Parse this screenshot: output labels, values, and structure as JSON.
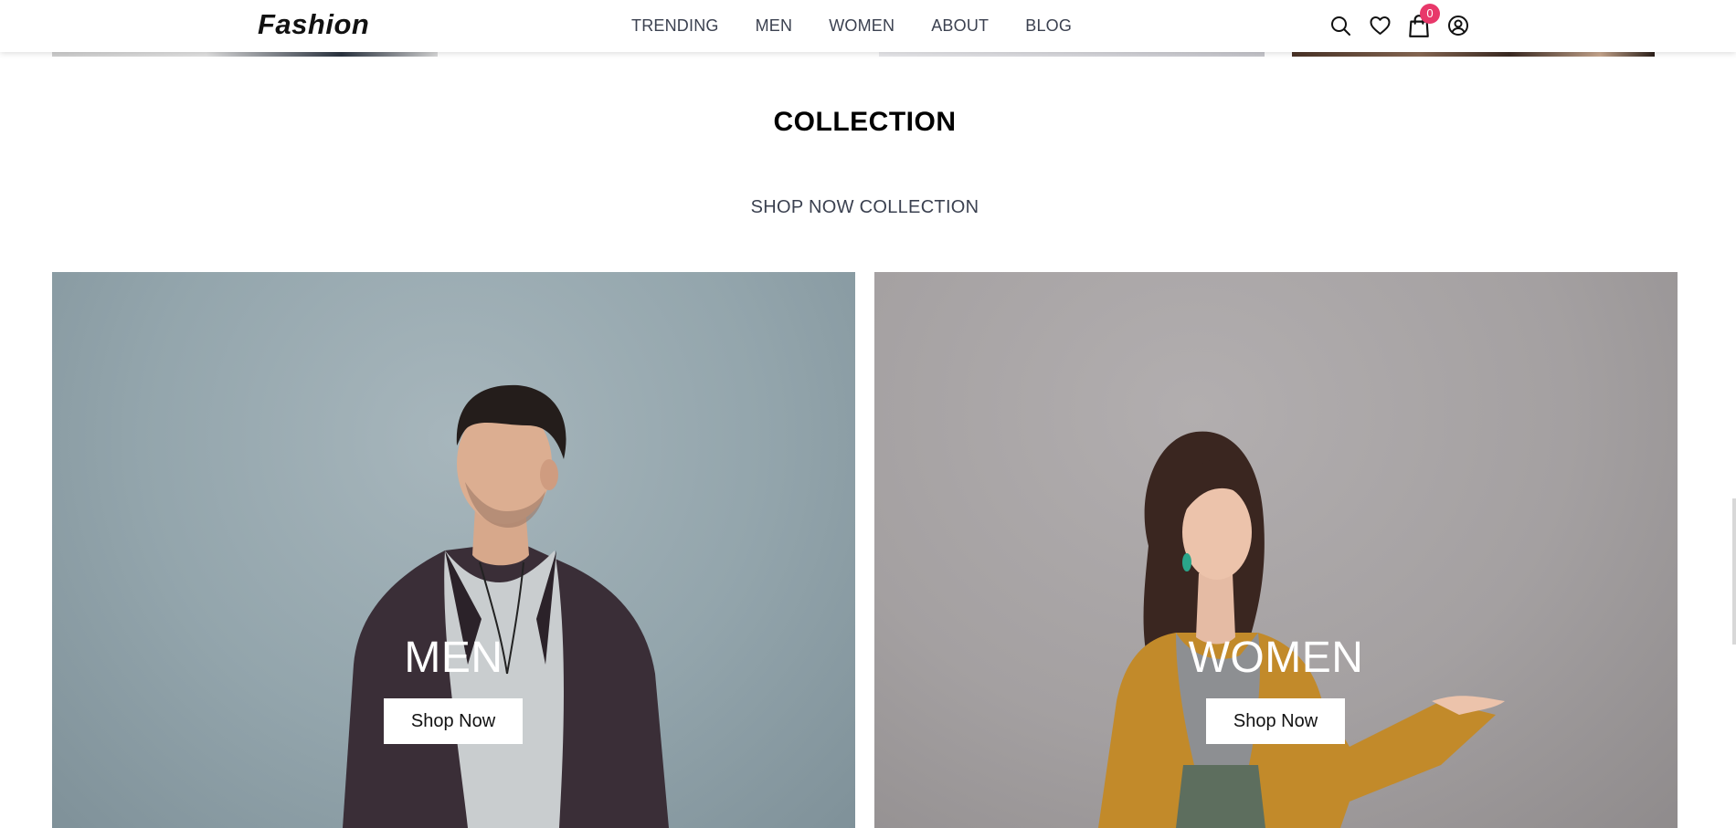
{
  "header": {
    "logo": "Fashion",
    "nav": [
      "TRENDING",
      "MEN",
      "WOMEN",
      "ABOUT",
      "BLOG"
    ],
    "cart_count": "0",
    "icons": [
      "search-icon",
      "heart-icon",
      "cart-icon",
      "user-icon"
    ]
  },
  "collection": {
    "title": "COLLECTION",
    "subtitle": "SHOP NOW COLLECTION",
    "cards": [
      {
        "label": "MEN",
        "button": "Shop Now"
      },
      {
        "label": "WOMEN",
        "button": "Shop Now"
      }
    ]
  },
  "colors": {
    "badge": "#e8386a",
    "nav_text": "#3b4150",
    "men_bg": "#93a5ac",
    "women_bg": "#a4a0a1"
  }
}
